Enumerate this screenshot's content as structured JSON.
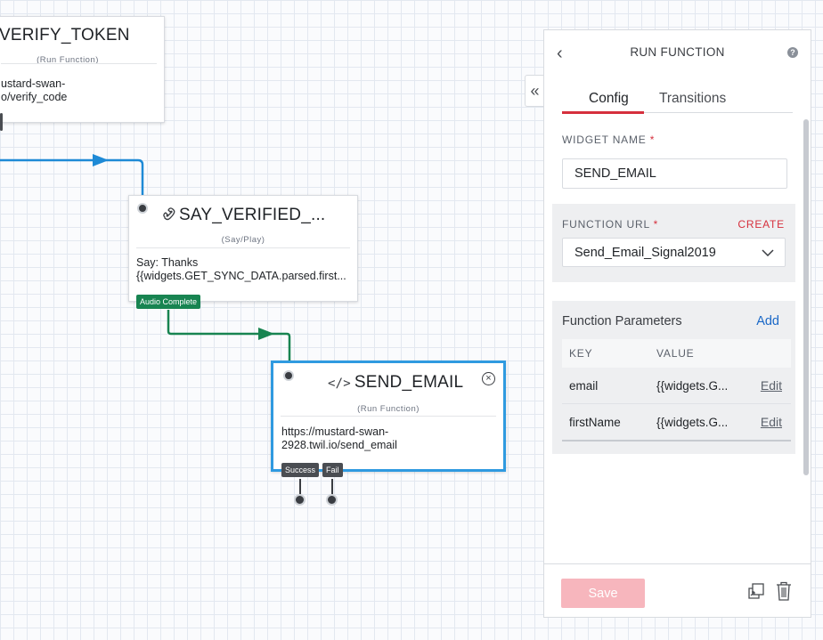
{
  "canvas": {
    "nodes": {
      "verify_token": {
        "title": "VERIFY_TOKEN",
        "subtitle": "(Run Function)",
        "body_line1": "ustard-swan-",
        "body_line2": "o/verify_code"
      },
      "say_verified": {
        "title": "SAY_VERIFIED_...",
        "subtitle": "(Say/Play)",
        "body_line1": "Say: Thanks",
        "body_line2": "{{widgets.GET_SYNC_DATA.parsed.first...",
        "transition": "Audio Complete"
      },
      "send_email": {
        "title": "SEND_EMAIL",
        "subtitle": "(Run Function)",
        "body_line1": "https://mustard-swan-",
        "body_line2": "2928.twil.io/send_email",
        "transition_success": "Success",
        "transition_fail": "Fail"
      }
    },
    "colors": {
      "wire_blue": "#1e8ad6",
      "wire_green": "#188451",
      "selection": "#2f9ae0"
    }
  },
  "panel": {
    "title": "RUN FUNCTION",
    "tabs": [
      {
        "label": "Config",
        "active": true
      },
      {
        "label": "Transitions",
        "active": false
      }
    ],
    "widget_name": {
      "label": "WIDGET NAME",
      "required_mark": "*",
      "value": "SEND_EMAIL"
    },
    "function_url": {
      "label": "FUNCTION URL",
      "required_mark": "*",
      "create_label": "CREATE",
      "selected": "Send_Email_Signal2019"
    },
    "function_parameters": {
      "title": "Function Parameters",
      "add_label": "Add",
      "columns": [
        "KEY",
        "VALUE"
      ],
      "rows": [
        {
          "key": "email",
          "value": "{{widgets.G...",
          "edit": "Edit"
        },
        {
          "key": "firstName",
          "value": "{{widgets.G...",
          "edit": "Edit"
        }
      ]
    },
    "save_label": "Save",
    "icons": {
      "back": "chevron-left-icon",
      "help": "help-icon",
      "collapse": "double-chevron-left-icon",
      "duplicate": "duplicate-icon",
      "delete": "trash-icon"
    }
  }
}
